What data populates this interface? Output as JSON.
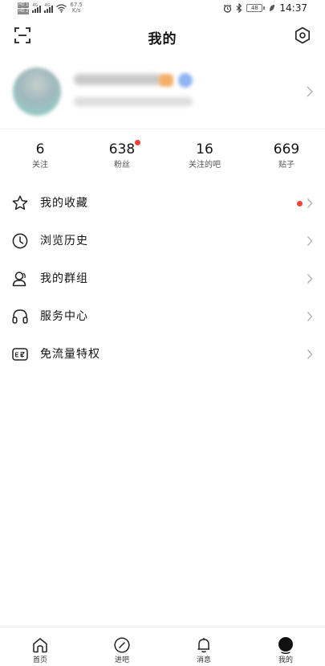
{
  "status_bar": {
    "sim1": "HD 1",
    "sim2": "HD 2",
    "net1": "4G",
    "net2": "4G",
    "speed_value": "67.5",
    "speed_unit": "K/s",
    "battery": "48",
    "time": "14:37"
  },
  "header": {
    "title": "我的",
    "scan_icon": "scan-icon",
    "settings_icon": "hexagon-settings-icon"
  },
  "profile": {
    "avatar_icon": "avatar",
    "name": "",
    "description": ""
  },
  "stats": [
    {
      "value": "6",
      "label": "关注",
      "dot": false
    },
    {
      "value": "638",
      "label": "粉丝",
      "dot": true
    },
    {
      "value": "16",
      "label": "关注的吧",
      "dot": false
    },
    {
      "value": "669",
      "label": "贴子",
      "dot": false
    }
  ],
  "menu": [
    {
      "label": "我的收藏",
      "icon": "star-icon",
      "dot": true
    },
    {
      "label": "浏览历史",
      "icon": "clock-icon",
      "dot": false
    },
    {
      "label": "我的群组",
      "icon": "user-icon",
      "dot": false
    },
    {
      "label": "服务中心",
      "icon": "headset-icon",
      "dot": false
    },
    {
      "label": "免流量特权",
      "icon": "free-data-icon",
      "dot": false
    }
  ],
  "bottom_nav": [
    {
      "label": "首页",
      "icon": "home-icon",
      "active": false
    },
    {
      "label": "进吧",
      "icon": "compass-icon",
      "active": false
    },
    {
      "label": "消息",
      "icon": "bell-icon",
      "active": false
    },
    {
      "label": "我的",
      "icon": "profile-filled-icon",
      "active": true
    }
  ],
  "colors": {
    "accent_dot": "#f44336",
    "text_primary": "#141414",
    "divider": "#f2f2f2"
  }
}
